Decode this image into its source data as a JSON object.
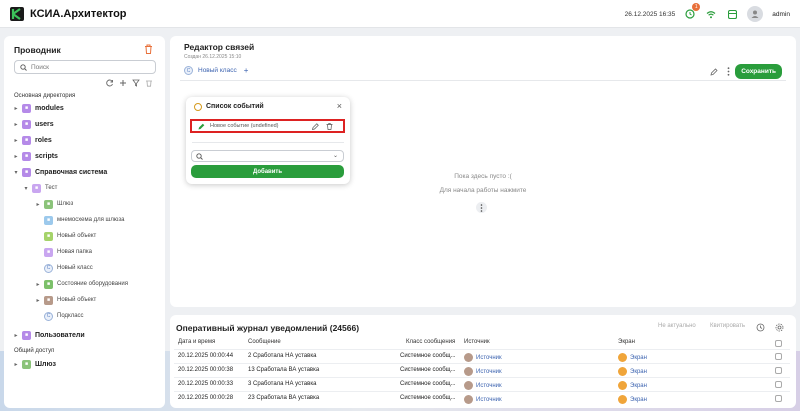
{
  "app": {
    "title": "КСИА.Архитектор",
    "datetime": "26.12.2025 16:35",
    "notification_count": "1",
    "username": "admin",
    "brand_color": "#2a9d3c"
  },
  "sidebar": {
    "title": "Проводник",
    "search_placeholder": "Поиск",
    "section_main": "Основная директория",
    "section_shared": "Общий доступ",
    "items": [
      {
        "label": "modules"
      },
      {
        "label": "users"
      },
      {
        "label": "roles"
      },
      {
        "label": "scripts"
      },
      {
        "label": "Справочная система"
      },
      {
        "label": "Тест"
      },
      {
        "label": "Шлюз"
      },
      {
        "label": "мнемосхема для шлюза"
      },
      {
        "label": "Новый объект"
      },
      {
        "label": "Новая папка"
      },
      {
        "label": "Новый класс"
      },
      {
        "label": "Состояние оборудования"
      },
      {
        "label": "Новый объект"
      },
      {
        "label": "Подкласс"
      },
      {
        "label": "Пользователи"
      },
      {
        "label": "Шлюз"
      }
    ]
  },
  "editor": {
    "title": "Редактор связей",
    "created": "Создан 26.12.2025 15:10",
    "tab_label": "Новый класс",
    "tab_icon_letter": "C",
    "save_label": "Сохранить",
    "empty_line1": "Пока здесь пусто :(",
    "empty_line2": "Для начала работы нажмите"
  },
  "events_popup": {
    "title": "Список событий",
    "event_label": "Новое событие (undefined)",
    "add_label": "Добавить"
  },
  "journal": {
    "title": "Оперативный журнал уведомлений (24566)",
    "btn_not_actual": "Не актуально",
    "btn_quote": "Квитировать",
    "headers": {
      "datetime": "Дата и время",
      "message": "Сообщение",
      "class": "Класс сообщения",
      "source": "Источник",
      "screen": "Экран"
    },
    "rows": [
      {
        "datetime": "20.12.2025 00:00:44",
        "message": "2 Сработала НА уставка",
        "class": "Системное сообщ...",
        "source": "Источник",
        "screen": "Экран"
      },
      {
        "datetime": "20.12.2025 00:00:38",
        "message": "13 Сработала ВА уставка",
        "class": "Системное сообщ...",
        "source": "Источник",
        "screen": "Экран"
      },
      {
        "datetime": "20.12.2025 00:00:33",
        "message": "3 Сработала НА уставка",
        "class": "Системное сообщ...",
        "source": "Источник",
        "screen": "Экран"
      },
      {
        "datetime": "20.12.2025 00:00:28",
        "message": "23 Сработала ВА уставка",
        "class": "Системное сообщ...",
        "source": "Источник",
        "screen": "Экран"
      }
    ]
  }
}
